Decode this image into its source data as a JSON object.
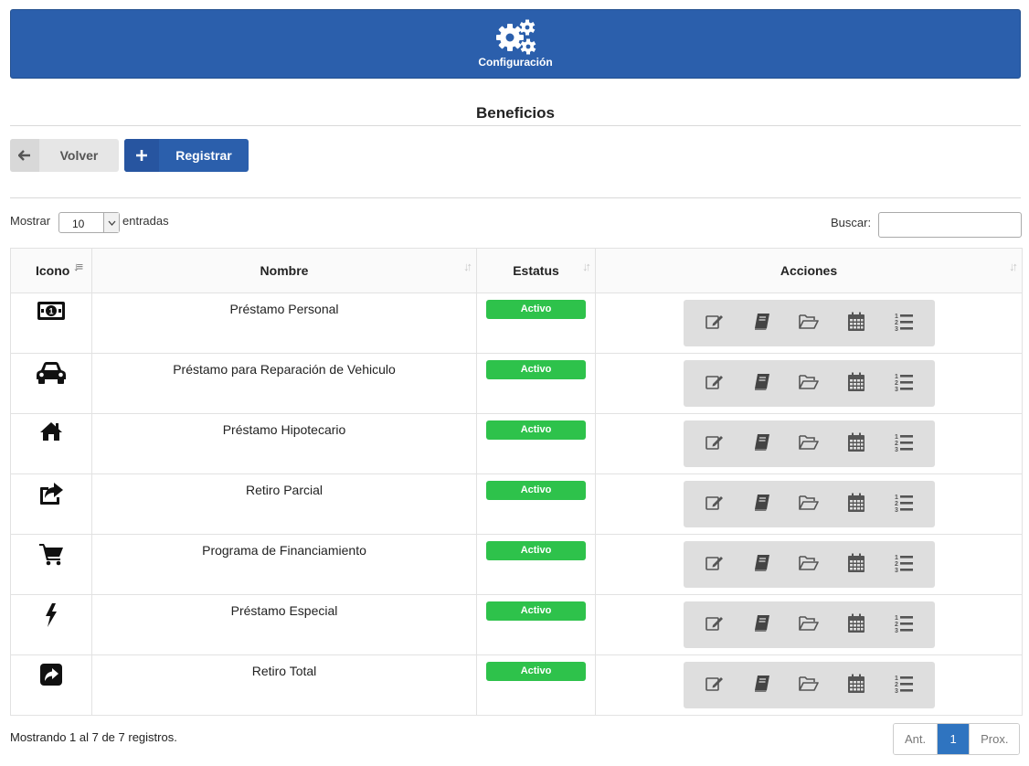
{
  "header": {
    "title": "Configuración",
    "icon": "gears-icon",
    "bg_color": "#2b5fac"
  },
  "page": {
    "title": "Beneficios"
  },
  "toolbar": {
    "back_label": "Volver",
    "register_label": "Registrar"
  },
  "table_controls": {
    "show_prefix": "Mostrar",
    "show_value": "10",
    "show_suffix": "entradas",
    "search_label": "Buscar:",
    "search_value": ""
  },
  "table": {
    "columns": [
      "Icono",
      "Nombre",
      "Estatus",
      "Acciones"
    ],
    "rows": [
      {
        "icon": "money-bill-icon",
        "name": "Préstamo Personal",
        "status": "Activo"
      },
      {
        "icon": "car-icon",
        "name": "Préstamo para Reparación de Vehiculo",
        "status": "Activo"
      },
      {
        "icon": "home-icon",
        "name": "Préstamo Hipotecario",
        "status": "Activo"
      },
      {
        "icon": "share-square-icon",
        "name": "Retiro Parcial",
        "status": "Activo"
      },
      {
        "icon": "shopping-cart-icon",
        "name": "Programa de Financiamiento",
        "status": "Activo"
      },
      {
        "icon": "bolt-icon",
        "name": "Préstamo Especial",
        "status": "Activo"
      },
      {
        "icon": "share-box-icon",
        "name": "Retiro Total",
        "status": "Activo"
      }
    ],
    "actions": [
      "edit-icon",
      "book-icon",
      "folder-open-icon",
      "calendar-icon",
      "ordered-list-icon"
    ],
    "status_color": "#2ec24b"
  },
  "footer": {
    "info": "Mostrando 1 al 7 de 7 registros.",
    "prev_label": "Ant.",
    "current_page": "1",
    "next_label": "Prox."
  }
}
